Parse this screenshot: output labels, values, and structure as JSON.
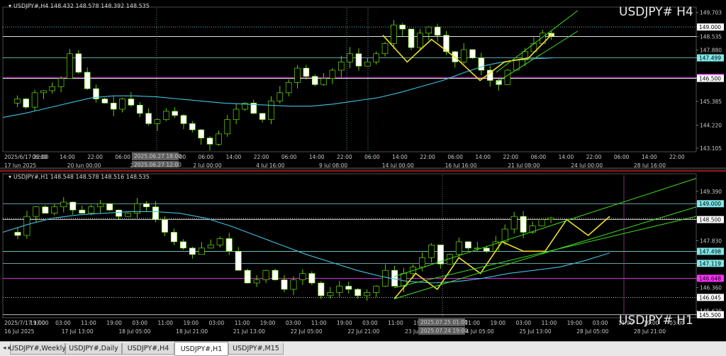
{
  "tabs": [
    {
      "label": "USDJPY#,Weekly",
      "active": false
    },
    {
      "label": "USDJPY#,Daily",
      "active": false
    },
    {
      "label": "USDJPY#,H4",
      "active": false
    },
    {
      "label": "USDJPY#,H1",
      "active": true
    },
    {
      "label": "USDJPY#,M15",
      "active": false
    }
  ],
  "chart_data": [
    {
      "type": "candlestick",
      "header": "USDJPY#,H4  148.432 148.578 148.392 148.535",
      "watermark": "USDJPY#  H4",
      "ylim": [
        143.0,
        149.9
      ],
      "price_ticks": [
        "149.703",
        "149.000",
        "148.535",
        "147.880",
        "147.499",
        "146.545",
        "146.500",
        "145.385",
        "144.220",
        "143.105"
      ],
      "price_levels": [
        {
          "value": 149.0,
          "label": "149.000",
          "color": "#7fd8d8",
          "style": "dotted",
          "tag": "white"
        },
        {
          "value": 148.535,
          "label": "148.535",
          "color": "#ffffff",
          "style": "solid",
          "tag": "none"
        },
        {
          "value": 147.499,
          "label": "147.499",
          "color": "#7fd8d8",
          "style": "solid",
          "tag": "cyan"
        },
        {
          "value": 146.545,
          "label": "146.545",
          "color": "#ff30ff",
          "style": "solid",
          "tag": "magenta"
        },
        {
          "value": 146.5,
          "label": "146.500",
          "color": "#ffffff",
          "style": "solid",
          "tag": "white"
        }
      ],
      "time_labels": [
        "2025/6/17 22:00",
        "06:00",
        "14:00",
        "22:00",
        "06:00",
        "14:00",
        "22:00",
        "06:00",
        "14:00",
        "22:00",
        "06:00",
        "14:00",
        "22:00",
        "06:00",
        "14:00",
        "22:00",
        "06:00",
        "14:00",
        "22:00",
        "06:00",
        "14:00",
        "22:00",
        "06:00",
        "14:00",
        "22:00"
      ],
      "date_labels": [
        "17 Jun 2025",
        "20 Jun 00:00",
        "24 Jun 16:00",
        "2 Jul 00:00",
        "4 Jul 16:00",
        "9 Jul 08:00",
        "14 Jul 00:00",
        "16 Jul 16:00",
        "21 Jul 08:00",
        "24 Jul 00:00",
        "28 Jul 16:00"
      ],
      "crosshair_labels": [
        "2025.06.27 18:00",
        "2025.06.27 12:00"
      ],
      "close_path": [
        145.3,
        145.5,
        145.1,
        145.8,
        145.9,
        146.1,
        146.5,
        147.7,
        146.8,
        146.0,
        145.5,
        145.3,
        145.0,
        145.5,
        145.2,
        144.8,
        144.3,
        144.5,
        144.9,
        144.7,
        144.3,
        144.0,
        143.6,
        143.3,
        143.8,
        144.5,
        145.0,
        145.3,
        144.8,
        144.5,
        145.4,
        145.8,
        146.3,
        147.0,
        146.6,
        146.2,
        146.5,
        146.9,
        147.3,
        147.7,
        147.1,
        147.3,
        147.7,
        148.2,
        149.1,
        148.9,
        148.0,
        148.7,
        149.0,
        148.6,
        147.8,
        147.3,
        147.9,
        147.5,
        146.9,
        146.4,
        146.2,
        146.9,
        147.4,
        147.8,
        148.2,
        148.7,
        148.55
      ],
      "ma_path": [
        144.6,
        144.8,
        145.05,
        145.3,
        145.55,
        145.65,
        145.65,
        145.6,
        145.5,
        145.4,
        145.3,
        145.25,
        145.2,
        145.15,
        145.15,
        145.25,
        145.4,
        145.55,
        145.8,
        146.1,
        146.4,
        146.8,
        147.15,
        147.35,
        147.45,
        147.5
      ],
      "zigzag": [
        [
          148.6,
          147.3
        ],
        [
          149.1,
          148.4
        ],
        [
          149.0,
          147.5
        ],
        [
          147.8,
          146.4
        ],
        [
          146.3,
          147.3
        ],
        [
          147.8,
          147.5
        ],
        [
          148.1,
          148.7
        ]
      ],
      "channel": {
        "lower_start": 146.3,
        "lower_end": 148.8,
        "upper_start": 146.8,
        "upper_end": 149.8
      }
    },
    {
      "type": "candlestick",
      "header": "USDJPY#,H1  148.548 148.578 148.516 148.535",
      "watermark": "USDJPY#  H1",
      "ylim": [
        145.45,
        149.9
      ],
      "price_ticks": [
        "149.390",
        "149.000",
        "148.535",
        "148.500",
        "147.830",
        "147.498",
        "147.119",
        "146.648",
        "146.360",
        "146.045",
        "145.620",
        "145.500"
      ],
      "price_levels": [
        {
          "value": 149.0,
          "label": "149.000",
          "color": "#7fd8d8",
          "style": "solid",
          "tag": "cyan"
        },
        {
          "value": 148.535,
          "label": "148.535",
          "color": "#ffffff",
          "style": "dotted",
          "tag": "none"
        },
        {
          "value": 148.5,
          "label": "148.500",
          "color": "#ffffff",
          "style": "solid",
          "tag": "white"
        },
        {
          "value": 147.498,
          "label": "147.498",
          "color": "#7fd8d8",
          "style": "solid",
          "tag": "cyan"
        },
        {
          "value": 147.119,
          "label": "147.119",
          "color": "#7fd8d8",
          "style": "solid",
          "tag": "cyan"
        },
        {
          "value": 146.648,
          "label": "146.648",
          "color": "#ff30ff",
          "style": "solid",
          "tag": "magenta"
        },
        {
          "value": 146.045,
          "label": "146.045",
          "color": "#ffffff",
          "style": "dotted",
          "tag": "white"
        },
        {
          "value": 145.5,
          "label": "145.500",
          "color": "#ffffff",
          "style": "solid",
          "tag": "white"
        }
      ],
      "time_labels": [
        "2025/7/17 17:00",
        "19:00",
        "03:00",
        "11:00",
        "19:00",
        "03:00",
        "11:00",
        "19:00",
        "03:00",
        "11:00",
        "19:00",
        "03:00",
        "11:00",
        "19:00",
        "03:00",
        "11:00",
        "19:00",
        "03:00",
        "11:00",
        "19:00",
        "03:00",
        "11:00",
        "19:00",
        "03:00",
        "11:00",
        "19:00",
        "03:00"
      ],
      "date_labels": [
        "16 Jul 2025",
        "17 Jul 13:00",
        "18 Jul 05:00",
        "18 Jul 21:00",
        "21 Jul 13:00",
        "22 Jul 05:00",
        "22 Jul 21:00",
        "23 Jul 13:00",
        "24 Jul 05:00",
        "25 Jul 13:00",
        "28 Jul 05:00",
        "28 Jul 21:00"
      ],
      "crosshair_labels": [
        "2025.07.25 01:00",
        "2025.07.24 19:00"
      ],
      "close_path": [
        148.1,
        148.0,
        148.6,
        148.9,
        148.7,
        148.9,
        149.05,
        148.8,
        148.7,
        148.9,
        149.0,
        148.8,
        148.6,
        148.7,
        149.0,
        148.9,
        148.5,
        148.1,
        147.8,
        147.6,
        147.4,
        147.6,
        147.7,
        147.9,
        147.5,
        146.9,
        146.5,
        146.6,
        146.9,
        146.6,
        146.3,
        146.6,
        146.8,
        146.5,
        146.1,
        146.2,
        146.4,
        146.3,
        146.1,
        146.2,
        146.4,
        146.9,
        146.4,
        146.8,
        147.0,
        147.3,
        147.7,
        147.1,
        147.4,
        147.8,
        147.6,
        147.6,
        147.5,
        147.8,
        148.2,
        148.6,
        148.1,
        148.3,
        148.5,
        148.55
      ],
      "ma_path": [
        148.1,
        148.35,
        148.55,
        148.65,
        148.7,
        148.75,
        148.75,
        148.7,
        148.55,
        148.3,
        148.0,
        147.7,
        147.4,
        147.15,
        146.9,
        146.7,
        146.55,
        146.5,
        146.55,
        146.65,
        146.8,
        146.9,
        147.0,
        147.2,
        147.45
      ],
      "zigzag": [
        [
          146.0,
          146.8
        ],
        [
          146.8,
          146.3
        ],
        [
          146.3,
          147.3
        ],
        [
          147.3,
          146.8
        ],
        [
          146.8,
          147.8
        ],
        [
          147.8,
          147.5
        ],
        [
          147.5,
          147.5
        ],
        [
          147.5,
          148.5
        ],
        [
          148.5,
          148.0
        ],
        [
          148.0,
          148.6
        ]
      ],
      "channels": [
        {
          "start": 146.0,
          "end": 148.9
        },
        {
          "start": 146.35,
          "end": 148.6
        },
        {
          "start": 146.7,
          "end": 149.8
        }
      ]
    }
  ]
}
